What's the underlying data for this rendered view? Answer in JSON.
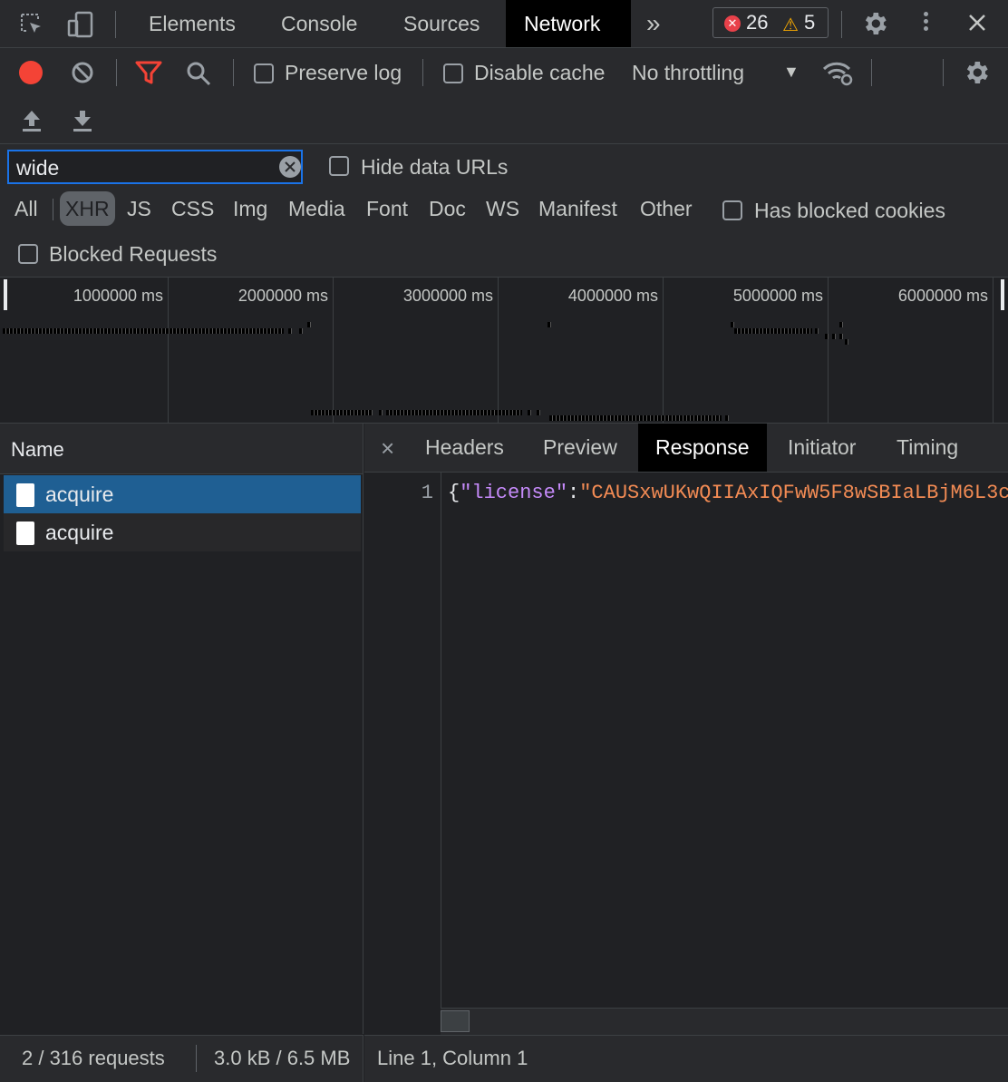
{
  "topbar": {
    "tabs": [
      "Elements",
      "Console",
      "Sources",
      "Network"
    ],
    "active_tab": "Network",
    "more": "»",
    "errors": "26",
    "warnings": "5"
  },
  "toolbar": {
    "preserve_log": "Preserve log",
    "disable_cache": "Disable cache",
    "throttling": "No throttling",
    "throttling_arrow": "▼"
  },
  "filter": {
    "search_value": "wide",
    "hide_data_urls": "Hide data URLs",
    "types": [
      "All",
      "XHR",
      "JS",
      "CSS",
      "Img",
      "Media",
      "Font",
      "Doc",
      "WS",
      "Manifest",
      "Other"
    ],
    "active_type": "XHR",
    "has_blocked_cookies": "Has blocked cookies",
    "blocked_requests": "Blocked Requests"
  },
  "overview": {
    "ticks": [
      "1000000 ms",
      "2000000 ms",
      "3000000 ms",
      "4000000 ms",
      "5000000 ms",
      "6000000 ms"
    ]
  },
  "requests": {
    "header": "Name",
    "rows": [
      "acquire",
      "acquire"
    ]
  },
  "detail": {
    "close": "×",
    "tabs": [
      "Headers",
      "Preview",
      "Response",
      "Initiator",
      "Timing"
    ],
    "active_tab": "Response",
    "line_number": "1",
    "code_open": "{",
    "code_key": "\"license\"",
    "code_colon": ":",
    "code_value": "\"CAUSxwUKwQIIAxIQFwW5F8wSBIaLBjM6L3c"
  },
  "status": {
    "requests": "2 / 316 requests",
    "transfer": "3.0 kB / 6.5 MB",
    "cursor": "Line 1, Column 1"
  },
  "colors": {
    "accent": "#1a73e8",
    "record": "#f44336",
    "filter_red": "#f44336",
    "selected_row": "#1f5f93",
    "json_key": "#c58af9",
    "json_string": "#f28b54"
  }
}
